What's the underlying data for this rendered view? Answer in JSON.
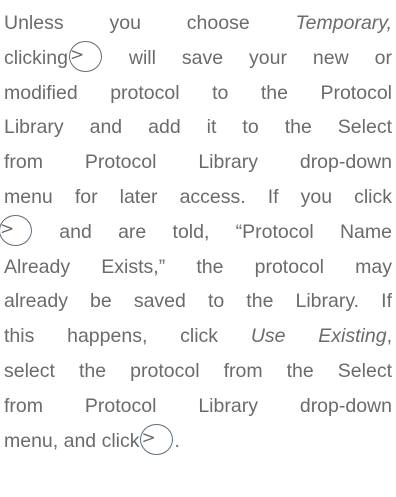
{
  "paragraph": {
    "l1_a": "Unless you choose ",
    "l1_em": "Temporary,",
    "l2_a": "clicking",
    "next_glyph": ">",
    "l2_b": " will save your new or",
    "l3": "modified protocol to the Protocol",
    "l4": "Library and add it to the Select",
    "l5": "from Protocol Library drop-down",
    "l6": "menu for later access. If you click",
    "l7_b": " and are told, “Protocol Name",
    "l8": "Already Exists,” the protocol may",
    "l9": "already be saved to the Library. If",
    "l10_a": "this happens, click ",
    "l10_em": "Use Existing",
    "l10_b": ",",
    "l11": "select the protocol from the Select",
    "l12": "from Protocol Library drop-down",
    "l13_a": "menu, and click",
    "l13_b": "."
  }
}
